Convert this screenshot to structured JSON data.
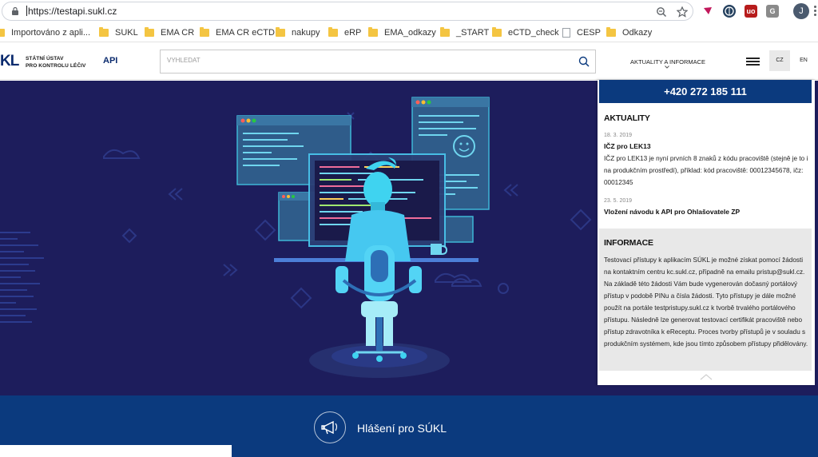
{
  "browser": {
    "url": "https://testapi.sukl.cz",
    "avatar_letter": "J",
    "ext_icons": [
      "red-flag-icon",
      "globe-icon",
      "ublock-icon",
      "gray-extension-icon"
    ],
    "bookmarks": [
      {
        "label": "Importováno z apli...",
        "icon": "folder-icon"
      },
      {
        "label": "SUKL",
        "icon": "folder-icon"
      },
      {
        "label": "EMA CR",
        "icon": "folder-icon"
      },
      {
        "label": "EMA CR eCTD",
        "icon": "folder-icon"
      },
      {
        "label": "nakupy",
        "icon": "folder-icon"
      },
      {
        "label": "eRP",
        "icon": "folder-icon"
      },
      {
        "label": "EMA_odkazy",
        "icon": "folder-icon"
      },
      {
        "label": "_START",
        "icon": "folder-icon"
      },
      {
        "label": "eCTD_check",
        "icon": "folder-icon"
      },
      {
        "label": "CESP",
        "icon": "page-icon"
      },
      {
        "label": "Odkazy",
        "icon": "folder-icon"
      }
    ]
  },
  "header": {
    "logo_partial": "KL",
    "logo_line1": "STÁTNÍ ÚSTAV",
    "logo_line2": "PRO KONTROLU LÉČIV",
    "api_label": "API",
    "search_placeholder": "VYHLEDAT",
    "news_menu": "AKTUALITY A INFORMACE",
    "lang_cz": "CZ",
    "lang_en": "EN"
  },
  "panel": {
    "phone": "+420 272 185 111",
    "news_title": "AKTUALITY",
    "news": [
      {
        "date": "18. 3. 2019",
        "headline": "IČZ pro LEK13",
        "body": "IČZ pro LEK13 je nyní prvních 8 znaků z kódu pracoviště (stejně je to i na produkčním prostředí), příklad: kód pracoviště: 00012345678, ičz: 00012345"
      },
      {
        "date": "23. 5. 2019",
        "headline": "Vložení návodu k API pro Ohlašovatele ZP",
        "body": ""
      }
    ],
    "info_title": "INFORMACE",
    "info_body": "Testovací přístupy k aplikacím SÚKL je možné získat pomocí žádosti na kontaktním centru kc.sukl.cz, případně na emailu pristup@sukl.cz. Na základě této žádosti Vám bude vygenerován dočasný portálový přístup v podobě PINu a čísla žádosti. Tyto přístupy je dále možné použít na portále testpristupy.sukl.cz k tvorbě trvalého portálového přístupu. Následně lze generovat testovací certifikát pracoviště nebo přístup zdravotníka k eReceptu. Proces tvorby přístupů je v souladu s produkčním systémem, kde jsou tímto způsobem přístupy přidělovány."
  },
  "footer": {
    "report_label": "Hlášení pro SÚKL"
  },
  "colors": {
    "hero_bg": "#1d1d5c",
    "brand_blue": "#0b3a7e",
    "accent_cyan": "#3fd3f0"
  }
}
